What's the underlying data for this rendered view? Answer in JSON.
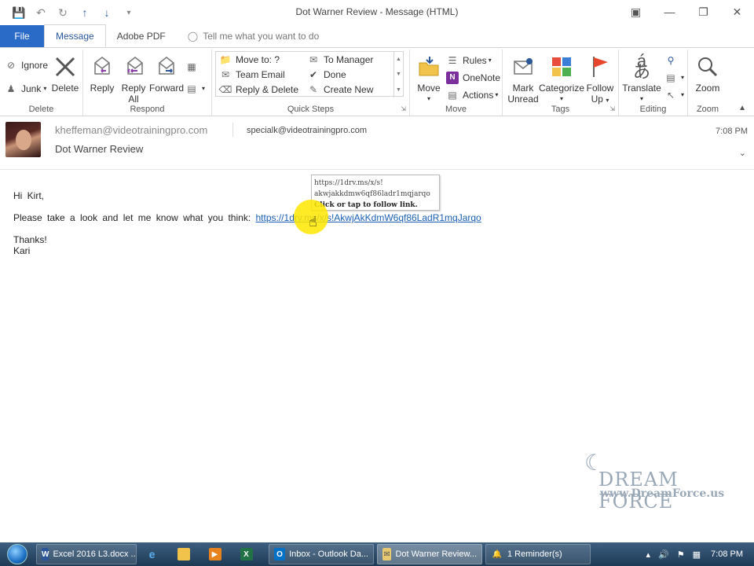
{
  "window": {
    "title": "Dot Warner Review - Message (HTML)"
  },
  "ribbon_tabs": [
    {
      "label": "File"
    },
    {
      "label": "Message"
    },
    {
      "label": "Adobe PDF"
    },
    {
      "label": "Tell me what you want to do"
    }
  ],
  "ribbon": {
    "delete_group": {
      "label": "Delete",
      "ignore": "Ignore",
      "junk": "Junk",
      "delete": "Delete"
    },
    "respond_group": {
      "label": "Respond",
      "reply": "Reply",
      "reply_all_1": "Reply",
      "reply_all_2": "All",
      "forward": "Forward"
    },
    "quick_steps_group": {
      "label": "Quick Steps",
      "items": [
        "Move to: ?",
        "To Manager",
        "Team Email",
        "Done",
        "Reply & Delete",
        "Create New"
      ]
    },
    "move_group": {
      "label": "Move",
      "move": "Move",
      "rules": "Rules",
      "onenote": "OneNote",
      "actions": "Actions"
    },
    "tags_group": {
      "label": "Tags",
      "mark_unread_1": "Mark",
      "mark_unread_2": "Unread",
      "categorize": "Categorize",
      "follow_up_1": "Follow",
      "follow_up_2": "Up"
    },
    "editing_group": {
      "label": "Editing",
      "translate": "Translate"
    },
    "zoom_group": {
      "label": "Zoom",
      "zoom": "Zoom"
    }
  },
  "message": {
    "from": "kheffeman@videotrainingpro.com",
    "to": "specialk@videotrainingpro.com",
    "time": "7:08 PM",
    "subject": "Dot Warner Review",
    "greeting": "Hi Kirt,",
    "body_text": "Please take a look and let me know what you think:",
    "link": "https://1drv.ms/x/s!AkwjAkKdmW6qf86LadR1mqJarqo",
    "thanks": "Thanks!",
    "signature": "Kari"
  },
  "tooltip": {
    "line1": "https://1drv.ms/x/s!",
    "line2": "akwjakkdmw6qf86ladr1mqjarqo",
    "line3": "Click or tap to follow link."
  },
  "watermark": {
    "brand": "DREAM FORCE",
    "url": "www.DreamForce.us"
  },
  "taskbar": {
    "items": [
      {
        "label": "Excel 2016 L3.docx ..."
      },
      {
        "label": "Inbox - Outlook Da..."
      },
      {
        "label": "Dot Warner Review..."
      },
      {
        "label": "1 Reminder(s)"
      }
    ],
    "clock": "7:08 PM"
  }
}
